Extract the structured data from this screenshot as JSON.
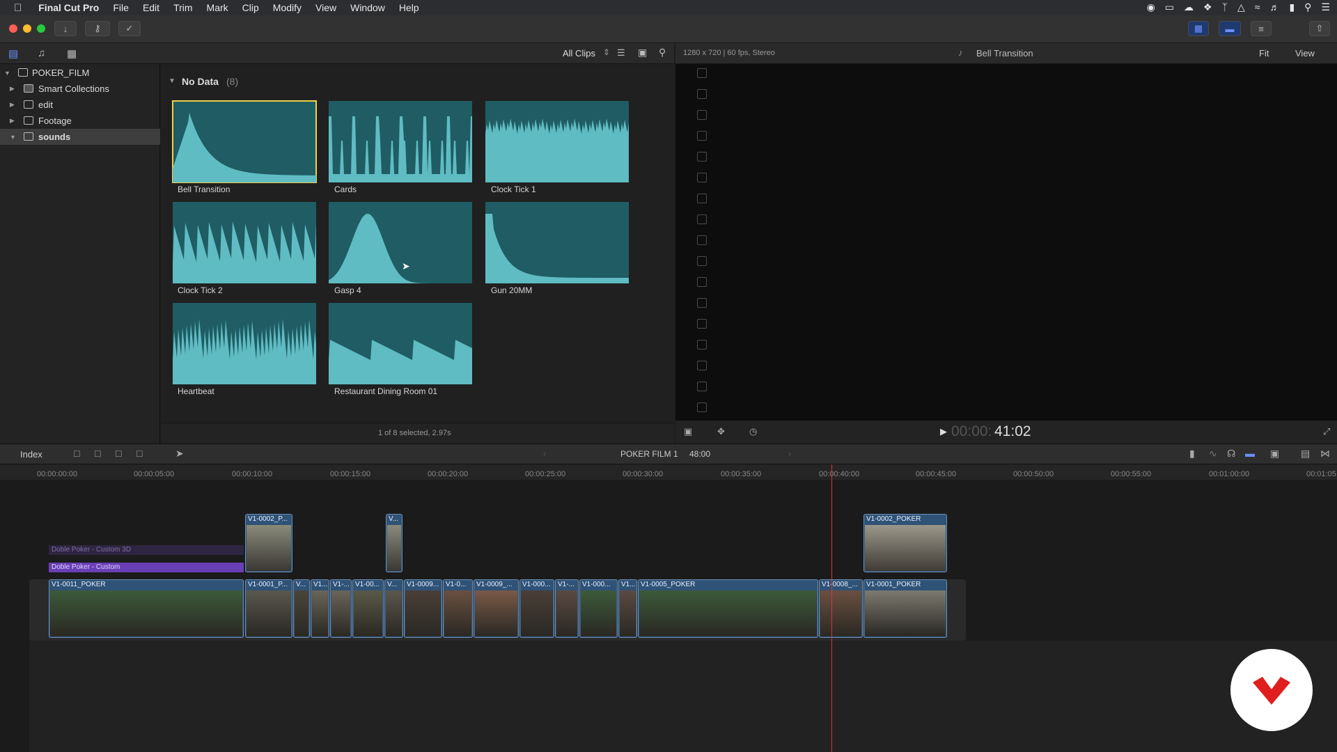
{
  "menubar": {
    "app": "Final Cut Pro",
    "items": [
      "File",
      "Edit",
      "Trim",
      "Mark",
      "Clip",
      "Modify",
      "View",
      "Window",
      "Help"
    ]
  },
  "library": {
    "name": "POKER_FILM",
    "items": [
      "Smart Collections",
      "edit",
      "Footage",
      "sounds"
    ],
    "selected": "sounds"
  },
  "browser": {
    "filter": "All Clips",
    "group_title": "No Data",
    "group_count": "(8)",
    "clips": [
      {
        "name": "Bell Transition",
        "selected": true
      },
      {
        "name": "Cards"
      },
      {
        "name": "Clock Tick 1"
      },
      {
        "name": "Clock Tick 2"
      },
      {
        "name": "Gasp 4"
      },
      {
        "name": "Gun 20MM"
      },
      {
        "name": "Heartbeat"
      },
      {
        "name": "Restaurant Dining Room 01"
      }
    ],
    "status": "1 of 8 selected, 2.97s"
  },
  "viewer": {
    "format": "1280 x 720 | 60 fps, Stereo",
    "title": "Bell Transition",
    "fit": "Fit",
    "view": "View",
    "timecode_dim": "00:00:",
    "timecode": "41:02"
  },
  "timeline": {
    "index": "Index",
    "project": "POKER FILM 1",
    "duration": "48:00",
    "ticks": [
      "00:00:00:00",
      "00:00:05:00",
      "00:00:10:00",
      "00:00:15:00",
      "00:00:20:00",
      "00:00:25:00",
      "00:00:30:00",
      "00:00:35:00",
      "00:00:40:00",
      "00:00:45:00",
      "00:00:50:00",
      "00:00:55:00",
      "00:01:00:00",
      "00:01:05"
    ],
    "titles": [
      "Doble Poker - Custom 3D",
      "Doble Poker - Custom"
    ],
    "connected_clips": [
      "V1-0002_P...",
      "V...",
      "V1-0002_POKER"
    ],
    "primary_clips": [
      "V1-0011_POKER",
      "V1-0001_P...",
      "V...",
      "V1...",
      "V1-...",
      "V1-00...",
      "V...",
      "V1-0009...",
      "V1-0...",
      "V1-0009_...",
      "V1-000...",
      "V1-...",
      "V1-000...",
      "V1...",
      "V1-0005_POKER",
      "V1-0008_...",
      "V1-0001_POKER"
    ]
  },
  "colors": {
    "waveform_bg": "#1f5c63",
    "waveform_fg": "#5fbcc2",
    "selection": "#f2d14b",
    "clip_blue": "#2f5277",
    "title_purple": "#6a3fb5",
    "playhead": "#dd3333"
  }
}
